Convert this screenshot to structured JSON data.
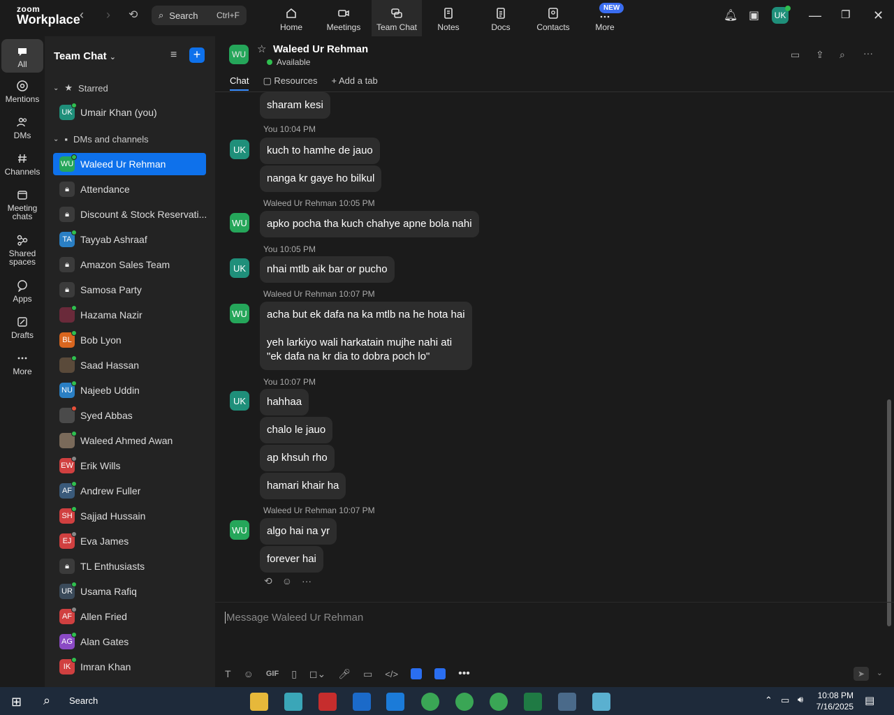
{
  "app": {
    "brand_top": "zoom",
    "brand_bottom": "Workplace"
  },
  "search": {
    "label": "Search",
    "shortcut": "Ctrl+F"
  },
  "top_tabs": [
    {
      "label": "Home"
    },
    {
      "label": "Meetings"
    },
    {
      "label": "Team Chat"
    },
    {
      "label": "Notes"
    },
    {
      "label": "Docs"
    },
    {
      "label": "Contacts"
    },
    {
      "label": "More"
    }
  ],
  "new_badge": "NEW",
  "profile_initials": "UK",
  "rail": [
    {
      "label": "All"
    },
    {
      "label": "Mentions"
    },
    {
      "label": "DMs"
    },
    {
      "label": "Channels"
    },
    {
      "label": "Meeting chats"
    },
    {
      "label": "Shared spaces"
    },
    {
      "label": "Apps"
    },
    {
      "label": "Drafts"
    },
    {
      "label": "More"
    }
  ],
  "sidebar": {
    "title": "Team Chat",
    "starred_label": "Starred",
    "dms_label": "DMs and channels",
    "starred": [
      {
        "initials": "UK",
        "name": "Umair Khan (you)",
        "color": "#1f8f7a"
      }
    ],
    "items": [
      {
        "initials": "WU",
        "name": "Waleed Ur Rehman",
        "color": "#25a65a"
      },
      {
        "initials": "",
        "name": "Attendance",
        "color": "#3b3b3b"
      },
      {
        "initials": "",
        "name": "Discount & Stock Reservati...",
        "color": "#3b3b3b"
      },
      {
        "initials": "TA",
        "name": "Tayyab Ashraaf",
        "color": "#2a7fc4"
      },
      {
        "initials": "",
        "name": "Amazon Sales Team",
        "color": "#3b3b3b"
      },
      {
        "initials": "",
        "name": "Samosa Party",
        "color": "#3b3b3b"
      },
      {
        "initials": "",
        "name": "Hazama Nazir",
        "color": "#6a2a3a"
      },
      {
        "initials": "BL",
        "name": "Bob Lyon",
        "color": "#d9661f"
      },
      {
        "initials": "",
        "name": "Saad Hassan",
        "color": "#5a4a3a"
      },
      {
        "initials": "NU",
        "name": "Najeeb Uddin",
        "color": "#2a7fc4"
      },
      {
        "initials": "",
        "name": "Syed Abbas",
        "color": "#4a4a4a"
      },
      {
        "initials": "",
        "name": "Waleed Ahmed Awan",
        "color": "#7a6a5a"
      },
      {
        "initials": "EW",
        "name": "Erik Wills",
        "color": "#d04040"
      },
      {
        "initials": "AF",
        "name": "Andrew Fuller",
        "color": "#3a5a7a"
      },
      {
        "initials": "SH",
        "name": "Sajjad Hussain",
        "color": "#d04040"
      },
      {
        "initials": "EJ",
        "name": "Eva James",
        "color": "#d04040"
      },
      {
        "initials": "",
        "name": "TL Enthusiasts",
        "color": "#3b3b3b"
      },
      {
        "initials": "UR",
        "name": "Usama Rafiq",
        "color": "#3a4a5a"
      },
      {
        "initials": "AF",
        "name": "Allen Fried",
        "color": "#d04040"
      },
      {
        "initials": "AG",
        "name": "Alan Gates",
        "color": "#8a4ac4"
      },
      {
        "initials": "IK",
        "name": "Imran Khan",
        "color": "#d04040"
      }
    ]
  },
  "chat": {
    "name": "Waleed Ur Rehman",
    "initials": "WU",
    "status": "Available",
    "tabs": [
      "Chat",
      "Resources",
      "Add a tab"
    ],
    "messages": [
      {
        "text": "sharam kesi"
      },
      {
        "meta": "You 10:04 PM"
      },
      {
        "text": "kuch to hamhe de jauo"
      },
      {
        "text": "nanga kr gaye ho bilkul"
      },
      {
        "meta": "Waleed Ur Rehman 10:05 PM"
      },
      {
        "text": "apko pocha tha kuch chahye apne bola nahi"
      },
      {
        "meta": "You 10:05 PM"
      },
      {
        "text": "nhai mtlb aik bar or pucho"
      },
      {
        "meta": "Waleed Ur Rehman 10:07 PM"
      },
      {
        "text": "acha but ek dafa na ka mtlb na he hota hai\n\nyeh larkiyo wali harkatain mujhe nahi ati\n\"ek dafa na kr dia to dobra poch lo\""
      },
      {
        "meta": "You 10:07 PM"
      },
      {
        "text": "hahhaa"
      },
      {
        "text": "chalo le jauo"
      },
      {
        "text": "ap khsuh rho"
      },
      {
        "text": "hamari khair ha"
      },
      {
        "meta": "Waleed Ur Rehman 10:07 PM"
      },
      {
        "text": "algo hai na yr"
      },
      {
        "text": "forever hai"
      }
    ],
    "avatars": {
      "you": "UK",
      "other": "WU"
    },
    "composer_placeholder": "Message Waleed Ur Rehman",
    "gif_label": "GIF"
  },
  "taskbar": {
    "search": "Search",
    "time": "10:08 PM",
    "date": "7/16/2025"
  }
}
